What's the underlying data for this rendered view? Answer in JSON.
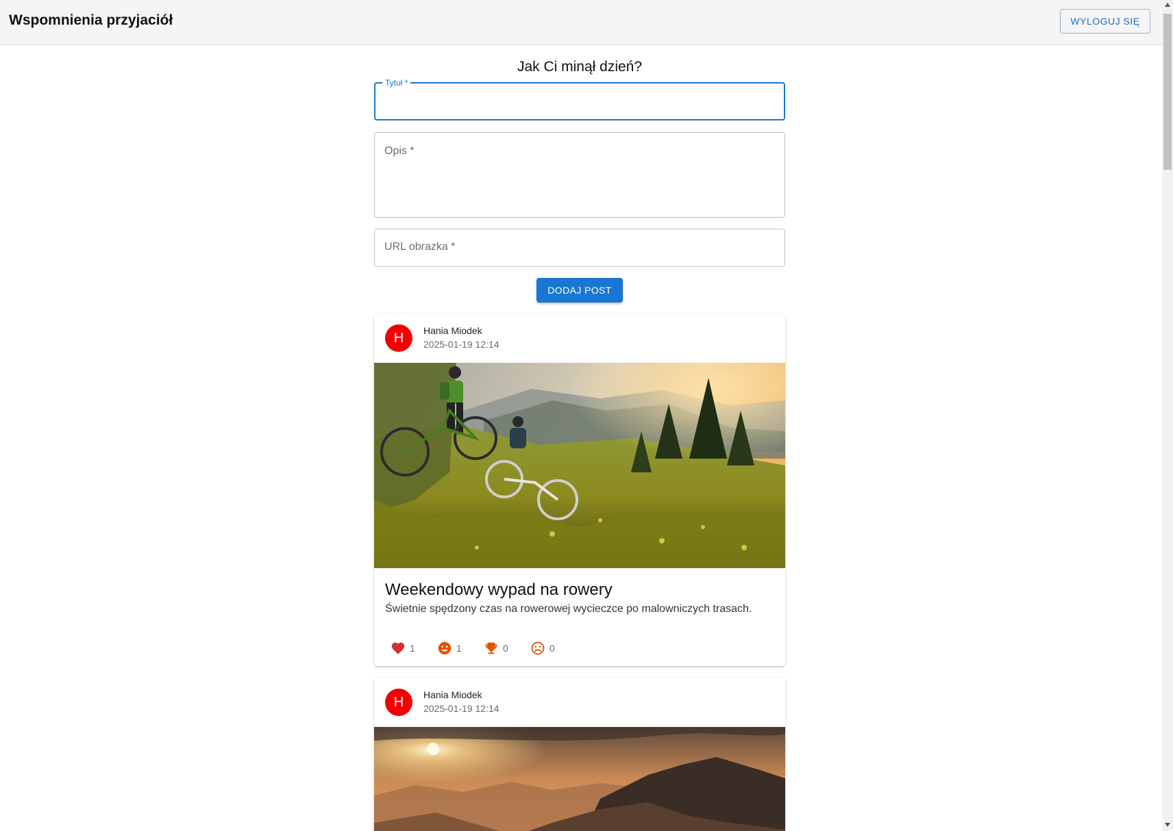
{
  "app": {
    "title": "Wspomnienia przyjaciół",
    "logout_label": "WYLOGUJ SIĘ"
  },
  "form": {
    "heading": "Jak Ci minął dzień?",
    "title_label": "Tytuł *",
    "title_value": "",
    "description_label": "Opis *",
    "description_value": "",
    "image_url_label": "URL obrazka *",
    "image_url_value": "",
    "submit_label": "DODAJ POST"
  },
  "posts": [
    {
      "avatar_letter": "H",
      "author": "Hania Miodek",
      "date": "2025-01-19 12:14",
      "image_subject": "mountain bikers resting on a grassy alpine slope at sunset",
      "title": "Weekendowy wypad na rowery",
      "description": "Świetnie spędzony czas na rowerowej wycieczce po malowniczych trasach.",
      "reactions": {
        "heart": "1",
        "smile": "1",
        "trophy": "0",
        "sad": "0"
      }
    },
    {
      "avatar_letter": "H",
      "author": "Hania Miodek",
      "date": "2025-01-19 12:14",
      "image_subject": "mountain range silhouette under a glowing sunset sky"
    }
  ],
  "icons": [
    "heart-icon",
    "smile-icon",
    "trophy-icon",
    "sad-icon"
  ],
  "colors": {
    "accent": "#1976d2",
    "avatar": "#f00000",
    "heart": "#d32f2f",
    "reaction_orange": "#e65100",
    "appbar_bg": "#f5f5f5"
  }
}
